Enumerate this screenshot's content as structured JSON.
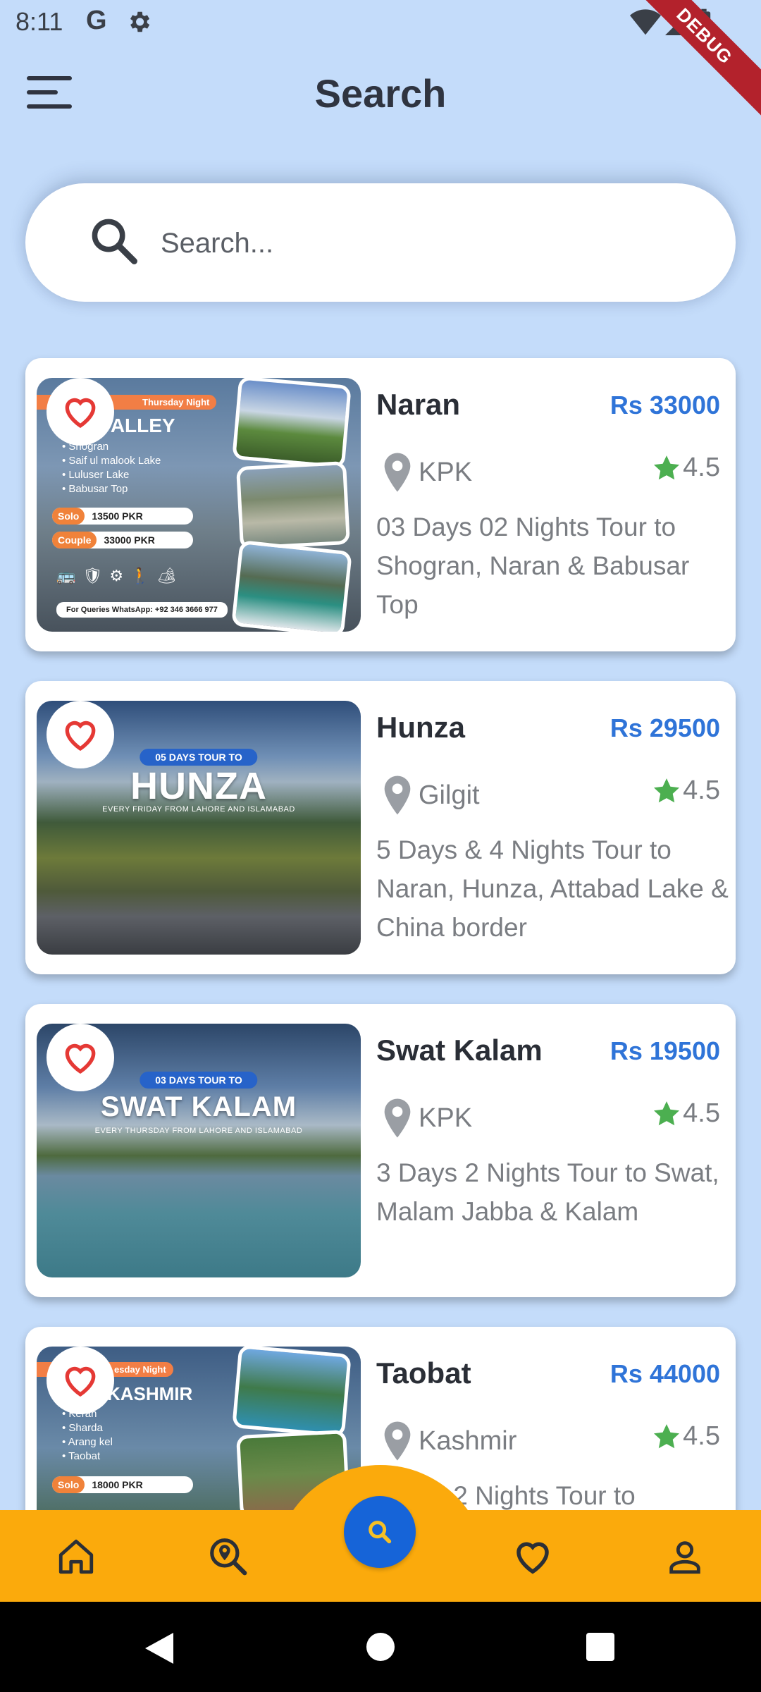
{
  "status_bar": {
    "time": "8:11",
    "g_label": "G",
    "debug_label": "DEBUG"
  },
  "header": {
    "title": "Search"
  },
  "search": {
    "placeholder": "Search..."
  },
  "tours": [
    {
      "title": "Naran",
      "price": "Rs 33000",
      "location": "KPK",
      "rating": "4.5",
      "description": "03 Days 02 Nights Tour to Shogran, Naran & Babusar Top",
      "poster": {
        "banner": "Thursday Night",
        "heading": "AN VALLEY",
        "stops": [
          "Shogran",
          "Saif ul malook Lake",
          "Luluser Lake",
          "Babusar Top"
        ],
        "solo_tag": "Solo",
        "solo_price": "13500 PKR",
        "couple_tag": "Couple",
        "couple_price": "33000 PKR",
        "contact": "For Queries WhatsApp: +92 346 3666 977"
      }
    },
    {
      "title": "Hunza",
      "price": "Rs 29500",
      "location": "Gilgit",
      "rating": "4.5",
      "description": "5 Days & 4 Nights Tour to Naran, Hunza, Attabad Lake & China border",
      "poster": {
        "badge": "05 DAYS TOUR TO",
        "heading": "HUNZA",
        "sub": "EVERY FRIDAY FROM LAHORE AND ISLAMABAD"
      }
    },
    {
      "title": "Swat Kalam",
      "price": "Rs 19500",
      "location": "KPK",
      "rating": "4.5",
      "description": "3 Days 2 Nights Tour to Swat, Malam Jabba & Kalam",
      "poster": {
        "badge": "03 DAYS TOUR TO",
        "heading": "SWAT KALAM",
        "sub": "EVERY THURSDAY FROM LAHORE AND ISLAMABAD"
      }
    },
    {
      "title": "Taobat",
      "price": "Rs 44000",
      "location": "Kashmir",
      "rating": "4.5",
      "description": "ys 2 Nights Tour to",
      "poster": {
        "banner": "esday Night",
        "heading": "AT KASHMIR",
        "stops": [
          "Keran",
          "Sharda",
          "Arang kel",
          "Taobat"
        ],
        "solo_tag": "Solo",
        "solo_price": "18000 PKR"
      }
    }
  ],
  "bottom_nav": {
    "items": [
      "home-icon",
      "search-location-icon",
      "search-icon",
      "heart-icon",
      "person-icon"
    ],
    "accent": "#fbaa0c",
    "fab_color": "#1664d8"
  },
  "colors": {
    "background": "#c4dcfa",
    "price": "#2f74d8",
    "star": "#4caf50",
    "heart": "#e53935"
  }
}
